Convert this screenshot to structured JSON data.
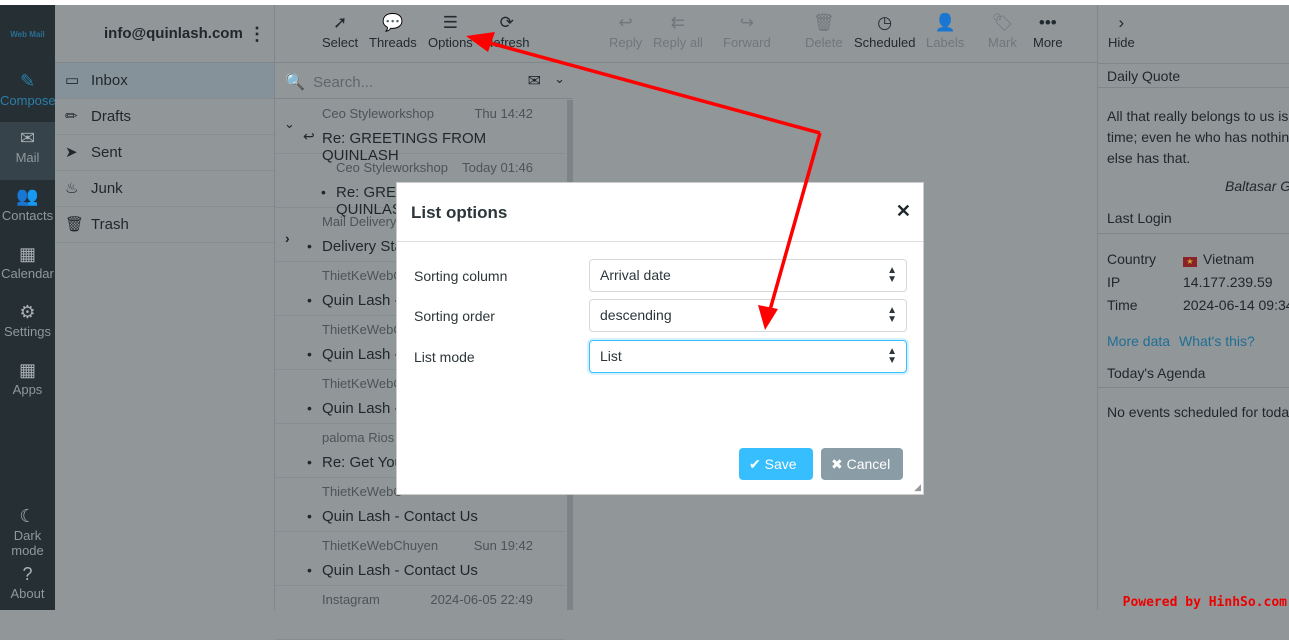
{
  "app": {
    "logo": "Web Mail",
    "account": "info@quinlash.com"
  },
  "nav": [
    {
      "label": "Compose",
      "icon": "edit-icon"
    },
    {
      "label": "Mail",
      "icon": "envelope-icon"
    },
    {
      "label": "Contacts",
      "icon": "users-icon"
    },
    {
      "label": "Calendar",
      "icon": "calendar-icon"
    },
    {
      "label": "Settings",
      "icon": "gear-icon"
    },
    {
      "label": "Apps",
      "icon": "grid-icon"
    }
  ],
  "nav_bottom": [
    {
      "label": "Dark mode",
      "icon": "moon-icon"
    },
    {
      "label": "About",
      "icon": "question-icon"
    }
  ],
  "folders": [
    {
      "label": "Inbox"
    },
    {
      "label": "Drafts"
    },
    {
      "label": "Sent"
    },
    {
      "label": "Junk"
    },
    {
      "label": "Trash"
    }
  ],
  "list_toolbar": {
    "select": "Select",
    "threads": "Threads",
    "options": "Options",
    "refresh": "Refresh"
  },
  "search": {
    "placeholder": "Search..."
  },
  "messages": [
    {
      "from": "Ceo Styleworkshop",
      "date": "Thu 14:42",
      "subject": "Re: GREETINGS FROM QUINLASH"
    },
    {
      "from": "Ceo Styleworkshop",
      "date": "Today 01:46",
      "subject": "Re: GREETINGS FROM QUINLASH"
    },
    {
      "from": "Mail Delivery",
      "date": "",
      "subject": "Delivery Sta"
    },
    {
      "from": "ThietKeWebC",
      "date": "",
      "subject": "Quin Lash -"
    },
    {
      "from": "ThietKeWebC",
      "date": "",
      "subject": "Quin Lash -"
    },
    {
      "from": "ThietKeWebC",
      "date": "",
      "subject": "Quin Lash -"
    },
    {
      "from": "paloma Rios",
      "date": "",
      "subject": "Re: Get Your"
    },
    {
      "from": "ThietKeWebC",
      "date": "",
      "subject": "Quin Lash - Contact Us"
    },
    {
      "from": "ThietKeWebChuyen",
      "date": "Sun 19:42",
      "subject": "Quin Lash - Contact Us"
    },
    {
      "from": "Instagram",
      "date": "2024-06-05 22:49",
      "subject": ""
    }
  ],
  "mail_toolbar": {
    "reply": "Reply",
    "reply_all": "Reply all",
    "forward": "Forward",
    "delete": "Delete",
    "scheduled": "Scheduled",
    "labels": "Labels",
    "mark": "Mark",
    "more": "More"
  },
  "right": {
    "hide": "Hide",
    "quote_title": "Daily Quote",
    "quote": "All that really belongs to us is time; even he who has nothing else has that.",
    "quote_author": "Baltasar Gracián",
    "login_title": "Last Login",
    "country_label": "Country",
    "country": "Vietnam",
    "ip_label": "IP",
    "ip": "14.177.239.59",
    "time_label": "Time",
    "time": "2024-06-14 09:34",
    "more_data": "More data",
    "whats_this": "What's this?",
    "agenda_title": "Today's Agenda",
    "agenda_empty": "No events scheduled for today"
  },
  "dialog": {
    "title": "List options",
    "fields": [
      {
        "label": "Sorting column",
        "value": "Arrival date"
      },
      {
        "label": "Sorting order",
        "value": "descending"
      },
      {
        "label": "List mode",
        "value": "List"
      }
    ],
    "save": "Save",
    "cancel": "Cancel"
  },
  "watermark": "Powered by HinhSo.com",
  "colors": {
    "accent": "#37beff",
    "annotation_arrow": "#ff0000"
  }
}
